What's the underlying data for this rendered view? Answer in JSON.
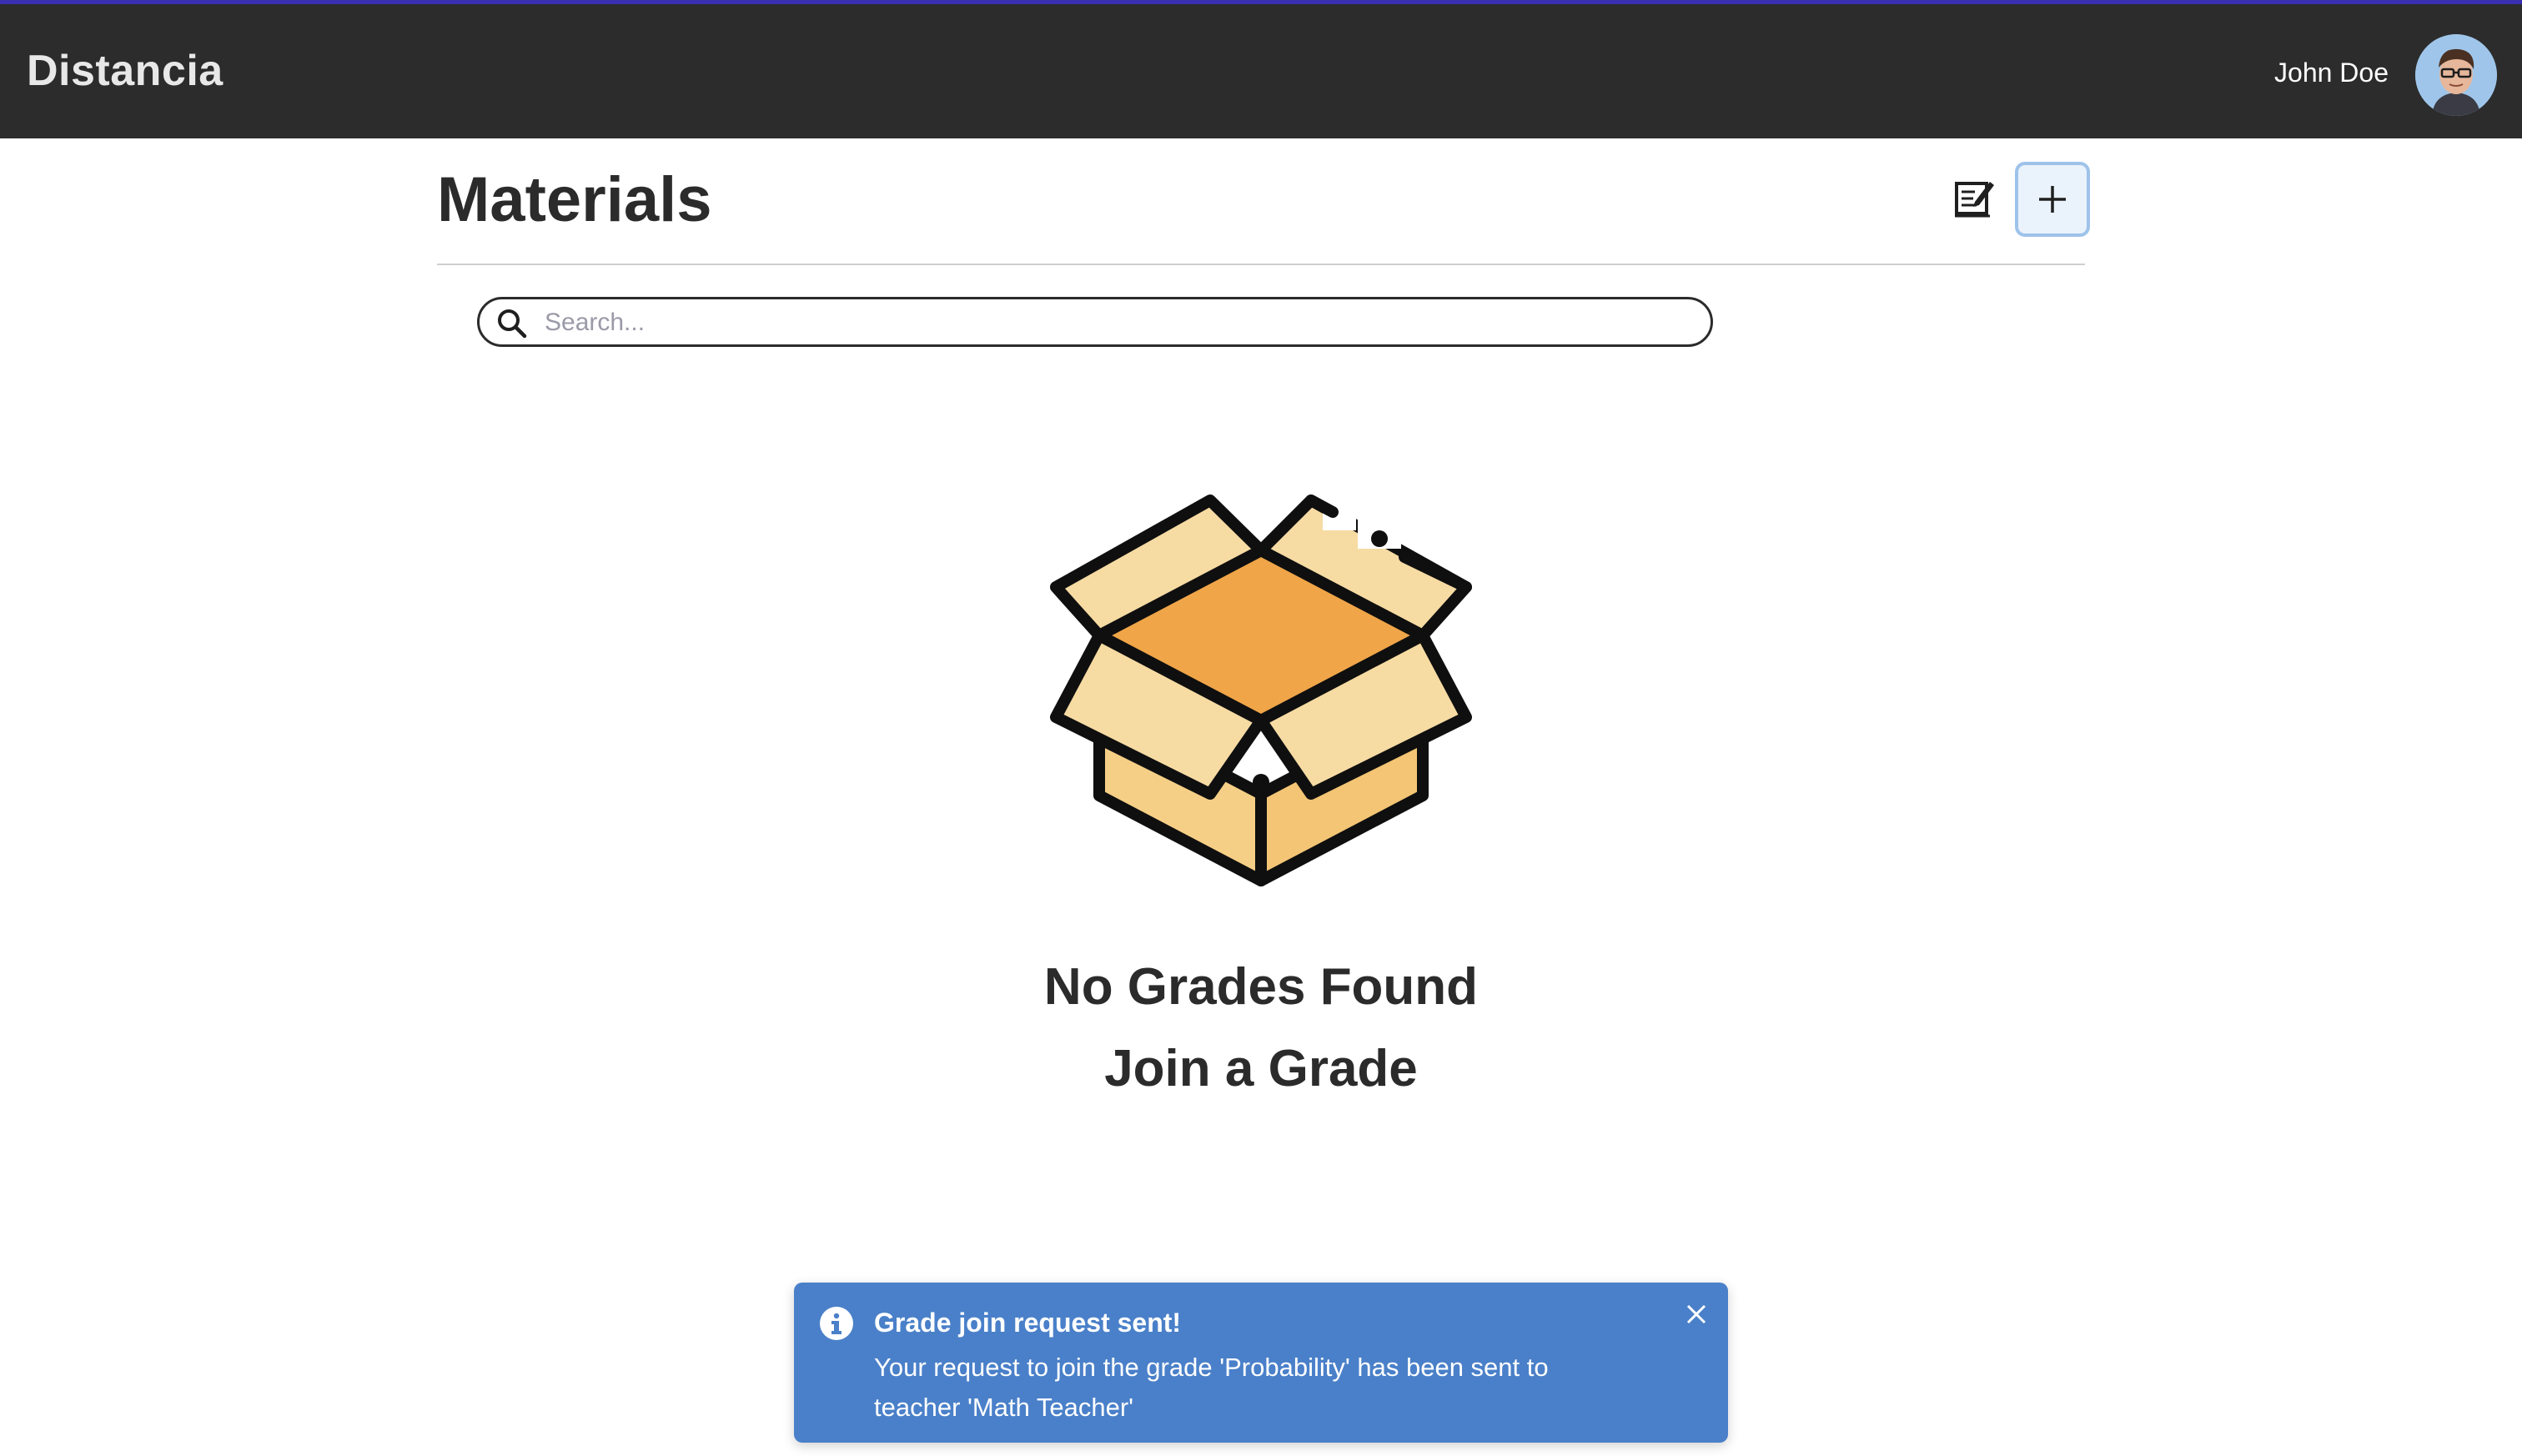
{
  "app": {
    "title": "Distancia"
  },
  "user": {
    "name": "John Doe",
    "avatar_icon": "user-avatar"
  },
  "page": {
    "title": "Materials",
    "actions": {
      "grades_icon": "edit-list-icon",
      "add_icon": "plus-icon"
    }
  },
  "search": {
    "placeholder": "Search...",
    "value": "",
    "icon": "search-icon"
  },
  "empty_state": {
    "icon": "open-box-icon",
    "title": "No Grades Found",
    "subtitle": "Join a Grade"
  },
  "toast": {
    "icon": "info-icon",
    "title": "Grade join request sent!",
    "message": "Your request to join the grade 'Probability' has been sent to teacher 'Math Teacher'",
    "close_icon": "close-icon",
    "color": "#4a80c9"
  },
  "colors": {
    "topbar": "#2c2c2c",
    "topbar_accent": "#3a2fb0",
    "box_lid": "#f6dba3",
    "box_inside": "#efa548",
    "box_body": "#f3c574"
  }
}
